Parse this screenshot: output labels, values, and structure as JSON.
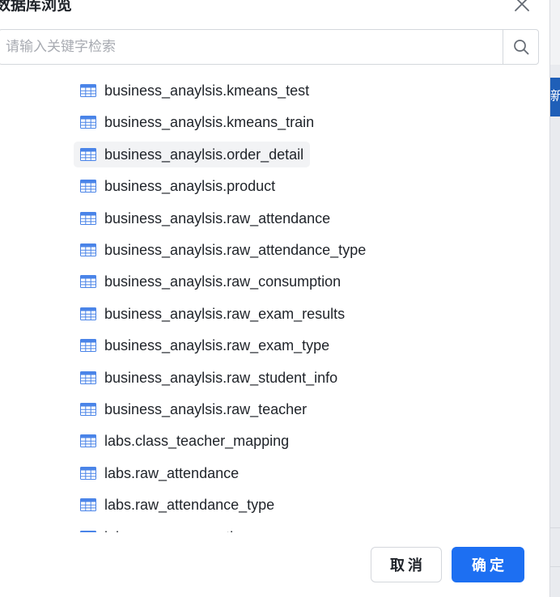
{
  "dialog": {
    "title": "数据库浏览",
    "search": {
      "placeholder": "请输入关键字检索",
      "value": ""
    },
    "tables": [
      "business_anaylsis.kmeans_test",
      "business_anaylsis.kmeans_train",
      "business_anaylsis.order_detail",
      "business_anaylsis.product",
      "business_anaylsis.raw_attendance",
      "business_anaylsis.raw_attendance_type",
      "business_anaylsis.raw_consumption",
      "business_anaylsis.raw_exam_results",
      "business_anaylsis.raw_exam_type",
      "business_anaylsis.raw_student_info",
      "business_anaylsis.raw_teacher",
      "labs.class_teacher_mapping",
      "labs.raw_attendance",
      "labs.raw_attendance_type",
      "labs.raw_consumption"
    ],
    "selected_index": 2,
    "buttons": {
      "cancel": "取消",
      "confirm": "确定"
    }
  },
  "background": {
    "button_fragment": "新"
  },
  "colors": {
    "accent": "#1d6ff2",
    "table_icon": "#4a84e8",
    "selected_bg": "#f2f3f5"
  },
  "icons": {
    "close": "close-icon",
    "search": "search-icon",
    "table": "table-icon"
  }
}
